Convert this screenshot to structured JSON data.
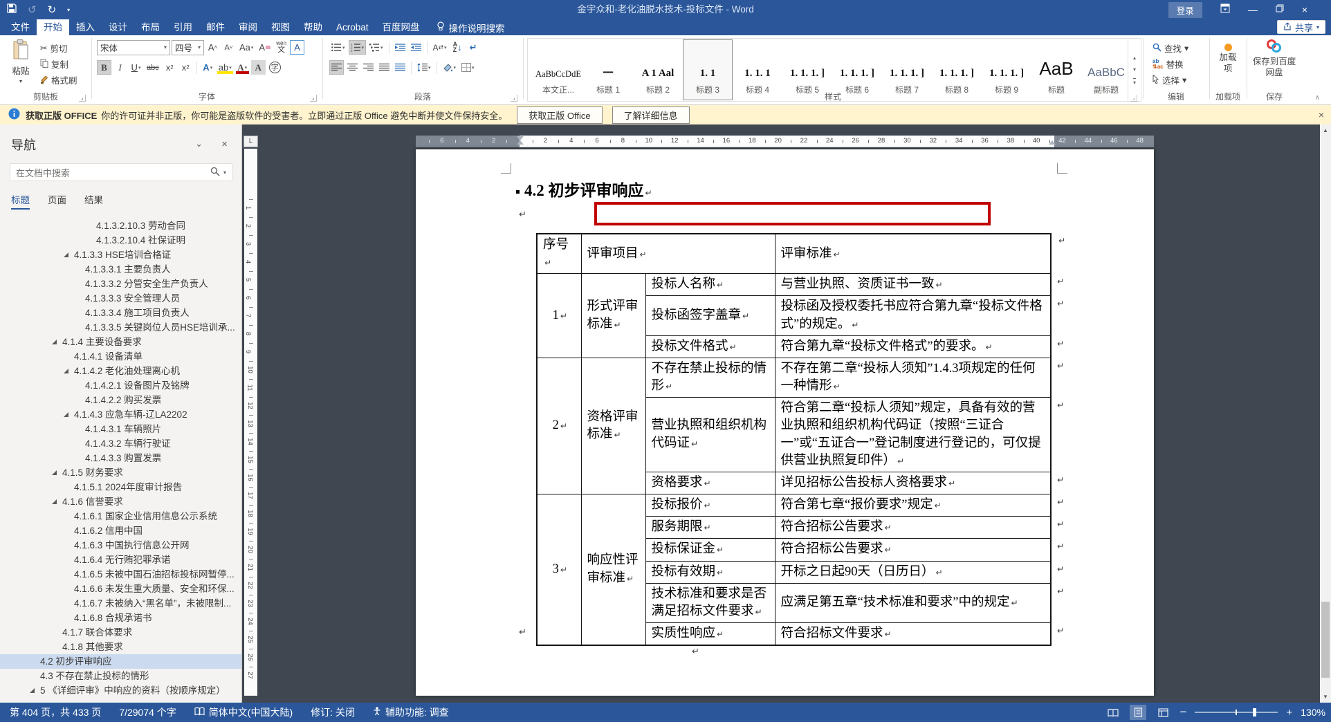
{
  "titlebar": {
    "title": "金宇众和-老化油脱水技术-投标文件 - Word",
    "signin": "登录"
  },
  "tabs": {
    "labels": [
      "文件",
      "开始",
      "插入",
      "设计",
      "布局",
      "引用",
      "邮件",
      "审阅",
      "视图",
      "帮助",
      "Acrobat",
      "百度网盘"
    ],
    "active": "开始",
    "assistant": "操作说明搜索",
    "share": "共享"
  },
  "ribbon": {
    "clipboard": {
      "label": "剪贴板",
      "paste": "粘贴",
      "cut": "剪切",
      "copy": "复制",
      "painter": "格式刷"
    },
    "font": {
      "label": "字体",
      "family": "宋体",
      "size": "四号",
      "bold": "B",
      "italic": "I",
      "underline": "U",
      "strike": "abc",
      "sub": "x",
      "sup": "x",
      "effects": "A",
      "highlight": "ab",
      "color": "A",
      "clear": "A",
      "shade": "A",
      "circle": "字",
      "pinyin_top": "wén",
      "pinyin_bottom": "文",
      "grow": "A",
      "shrink": "A",
      "case": "Aa"
    },
    "paragraph": {
      "label": "段落",
      "cjk": "A",
      "marks": "↵",
      "sort_a": "A",
      "sort_z": "Z"
    },
    "styles": {
      "label": "样式",
      "items": [
        {
          "preview": "AaBbCcDdE",
          "name": "本文正...",
          "kind": "body"
        },
        {
          "preview": "一",
          "name": "标题 1",
          "kind": "h"
        },
        {
          "preview": "A 1 Aal",
          "name": "标题 2",
          "kind": "h"
        },
        {
          "preview": "1. 1",
          "name": "标题 3",
          "kind": "h",
          "selected": true
        },
        {
          "preview": "1. 1. 1",
          "name": "标题 4",
          "kind": "h"
        },
        {
          "preview": "1. 1. 1. ]",
          "name": "标题 5",
          "kind": "h"
        },
        {
          "preview": "1. 1. 1. ]",
          "name": "标题 6",
          "kind": "h"
        },
        {
          "preview": "1. 1. 1. ]",
          "name": "标题 7",
          "kind": "h"
        },
        {
          "preview": "1. 1. 1. ]",
          "name": "标题 8",
          "kind": "h"
        },
        {
          "preview": "1. 1. 1. ]",
          "name": "标题 9",
          "kind": "h"
        },
        {
          "preview": "AaB",
          "name": "标题",
          "kind": "big"
        },
        {
          "preview": "AaBbC",
          "name": "副标题",
          "kind": "sub"
        }
      ]
    },
    "editing": {
      "label": "编辑",
      "find": "查找",
      "replace": "替换",
      "select": "选择"
    },
    "addins": {
      "group_label": "加载项",
      "button_label": "加载项"
    },
    "baidu": {
      "group_label": "保存",
      "button_label": "保存到百度网盘"
    }
  },
  "license_bar": {
    "bold": "获取正版 OFFICE",
    "text": "你的许可证并非正版，你可能是盗版软件的受害者。立即通过正版 Office 避免中断并使文件保持安全。",
    "btn_get": "获取正版 Office",
    "btn_learn": "了解详细信息"
  },
  "nav": {
    "title": "导航",
    "search_placeholder": "在文档中搜索",
    "tabs": [
      "标题",
      "页面",
      "结果"
    ],
    "active_tab": "标题",
    "items": [
      {
        "t": "4.1.3.2.10.3 劳动合同",
        "l": 4
      },
      {
        "t": "4.1.3.2.10.4 社保证明",
        "l": 4
      },
      {
        "t": "4.1.3.3 HSE培训合格证",
        "l": 2,
        "a": 1
      },
      {
        "t": "4.1.3.3.1 主要负责人",
        "l": 3
      },
      {
        "t": "4.1.3.3.2 分管安全生产负责人",
        "l": 3
      },
      {
        "t": "4.1.3.3.3 安全管理人员",
        "l": 3
      },
      {
        "t": "4.1.3.3.4 施工项目负责人",
        "l": 3
      },
      {
        "t": "4.1.3.3.5 关键岗位人员HSE培训承...",
        "l": 3
      },
      {
        "t": "4.1.4 主要设备要求",
        "l": 1,
        "a": 1
      },
      {
        "t": "4.1.4.1 设备清单",
        "l": 2
      },
      {
        "t": "4.1.4.2 老化油处理离心机",
        "l": 2,
        "a": 1
      },
      {
        "t": "4.1.4.2.1 设备图片及铭牌",
        "l": 3
      },
      {
        "t": "4.1.4.2.2 购买发票",
        "l": 3
      },
      {
        "t": "4.1.4.3 应急车辆-辽LA2202",
        "l": 2,
        "a": 1
      },
      {
        "t": "4.1.4.3.1 车辆照片",
        "l": 3
      },
      {
        "t": "4.1.4.3.2 车辆行驶证",
        "l": 3
      },
      {
        "t": "4.1.4.3.3 购置发票",
        "l": 3
      },
      {
        "t": "4.1.5 财务要求",
        "l": 1,
        "a": 1
      },
      {
        "t": "4.1.5.1 2024年度审计报告",
        "l": 2
      },
      {
        "t": "4.1.6 信誉要求",
        "l": 1,
        "a": 1
      },
      {
        "t": "4.1.6.1 国家企业信用信息公示系统",
        "l": 2
      },
      {
        "t": "4.1.6.2 信用中国",
        "l": 2
      },
      {
        "t": "4.1.6.3 中国执行信息公开网",
        "l": 2
      },
      {
        "t": "4.1.6.4 无行贿犯罪承诺",
        "l": 2
      },
      {
        "t": "4.1.6.5 未被中国石油招标投标网暂停...",
        "l": 2
      },
      {
        "t": "4.1.6.6 未发生重大质量、安全和环保...",
        "l": 2
      },
      {
        "t": "4.1.6.7 未被纳入“黑名单”，未被限制...",
        "l": 2
      },
      {
        "t": "4.1.6.8 合规承诺书",
        "l": 2
      },
      {
        "t": "4.1.7 联合体要求",
        "l": 1
      },
      {
        "t": "4.1.8 其他要求",
        "l": 1
      },
      {
        "t": "4.2 初步评审响应",
        "l": 0,
        "s": 1
      },
      {
        "t": "4.3 不存在禁止投标的情形",
        "l": 0
      },
      {
        "t": "5 《详细评审》中响应的资料（按顺序规定）",
        "l": 0,
        "a": 1
      }
    ]
  },
  "ruler": {
    "h_margin_numbers": [
      "2",
      "4"
    ],
    "h_numbers": [
      "2",
      "4",
      "6",
      "8",
      "10",
      "12",
      "14",
      "16",
      "18",
      "20",
      "22",
      "24",
      "26",
      "28",
      "30",
      "32",
      "34",
      "36",
      "38",
      "40",
      "42",
      "44",
      "46",
      "48"
    ],
    "v_numbers": [
      "1",
      "2",
      "3",
      "4",
      "5",
      "6",
      "7",
      "8",
      "9",
      "10",
      "11",
      "12",
      "13",
      "14",
      "15",
      "16",
      "17",
      "18",
      "19",
      "20",
      "21",
      "22",
      "23",
      "24",
      "25",
      "26",
      "27"
    ]
  },
  "document": {
    "heading": "4.2 初步评审响应",
    "pilcrow": "↵",
    "table": {
      "header": [
        "序号",
        "评审项目",
        "评审标准"
      ],
      "groups": [
        {
          "no": "1",
          "category": "形式评审标准",
          "rows": [
            {
              "item": "投标人名称",
              "criteria": "与营业执照、资质证书一致"
            },
            {
              "item": "投标函签字盖章",
              "criteria": "投标函及授权委托书应符合第九章“投标文件格式”的规定。"
            },
            {
              "item": "投标文件格式",
              "criteria": "符合第九章“投标文件格式”的要求。"
            }
          ]
        },
        {
          "no": "2",
          "category": "资格评审标准",
          "rows": [
            {
              "item": "不存在禁止投标的情形",
              "criteria": "不存在第二章“投标人须知”1.4.3项规定的任何一种情形"
            },
            {
              "item": "营业执照和组织机构代码证",
              "criteria": "符合第二章“投标人须知”规定，具备有效的营业执照和组织机构代码证（按照“三证合一”或“五证合一”登记制度进行登记的，可仅提供营业执照复印件）"
            },
            {
              "item": "资格要求",
              "criteria": "详见招标公告投标人资格要求"
            }
          ]
        },
        {
          "no": "3",
          "category": "响应性评审标准",
          "rows": [
            {
              "item": "投标报价",
              "criteria": "符合第七章“报价要求”规定"
            },
            {
              "item": "服务期限",
              "criteria": "符合招标公告要求"
            },
            {
              "item": "投标保证金",
              "criteria": "符合招标公告要求"
            },
            {
              "item": "投标有效期",
              "criteria": "开标之日起90天（日历日）"
            },
            {
              "item": "技术标准和要求是否满足招标文件要求",
              "criteria": "应满足第五章“技术标准和要求”中的规定"
            },
            {
              "item": "实质性响应",
              "criteria": "符合招标文件要求"
            }
          ]
        }
      ]
    }
  },
  "statusbar": {
    "page": "第 404 页，共 433 页",
    "words": "7/29074 个字",
    "language": "简体中文(中国大陆)",
    "track": "修订: 关闭",
    "accessibility": "辅助功能: 调查",
    "zoom": "130%"
  }
}
